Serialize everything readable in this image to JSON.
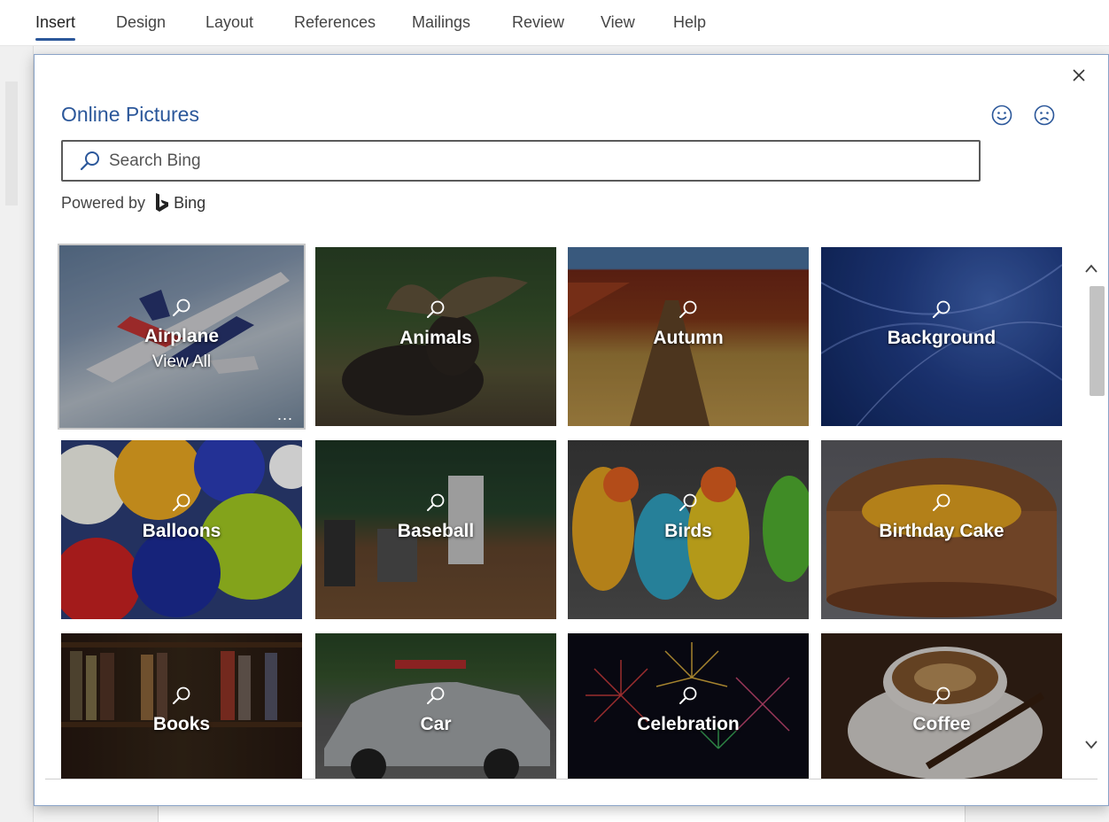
{
  "ribbon": {
    "tabs": [
      {
        "label": "Insert",
        "active": true
      },
      {
        "label": "Design"
      },
      {
        "label": "Layout"
      },
      {
        "label": "References"
      },
      {
        "label": "Mailings"
      },
      {
        "label": "Review"
      },
      {
        "label": "View"
      },
      {
        "label": "Help"
      }
    ]
  },
  "dialog": {
    "title": "Online Pictures",
    "close_icon": "close-icon",
    "feedback": {
      "happy_icon": "smile-icon",
      "sad_icon": "frown-icon"
    },
    "search": {
      "placeholder": "Search Bing",
      "value": ""
    },
    "powered_by": {
      "label": "Powered by",
      "brand": "Bing"
    },
    "accent_color": "#2b579a"
  },
  "categories": [
    {
      "label": "Airplane",
      "sub": "View All",
      "more": "...",
      "selected": true
    },
    {
      "label": "Animals"
    },
    {
      "label": "Autumn"
    },
    {
      "label": "Background"
    },
    {
      "label": "Balloons"
    },
    {
      "label": "Baseball"
    },
    {
      "label": "Birds"
    },
    {
      "label": "Birthday Cake"
    },
    {
      "label": "Books"
    },
    {
      "label": "Car"
    },
    {
      "label": "Celebration"
    },
    {
      "label": "Coffee"
    }
  ],
  "scrollbar": {
    "up_icon": "chevron-up-icon",
    "down_icon": "chevron-down-icon"
  }
}
